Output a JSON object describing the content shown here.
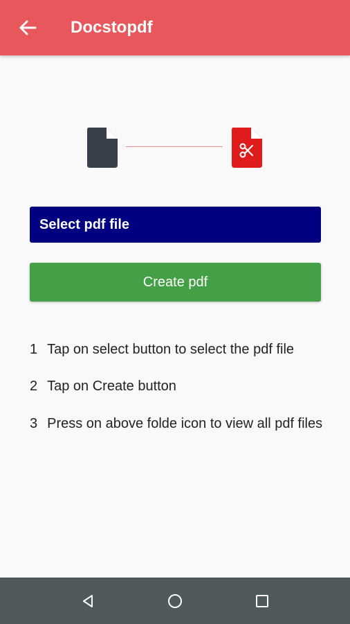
{
  "appbar": {
    "title": "Docstopdf",
    "back_icon": "arrow-left-icon",
    "color": "#e8575b"
  },
  "illustration": {
    "source_icon": "document-icon",
    "target_icon": "pdf-scissors-icon",
    "source_color": "#37404a",
    "target_color": "#e01b1b"
  },
  "buttons": {
    "select_label": "Select pdf file",
    "create_label": "Create pdf",
    "select_color": "#000080",
    "create_color": "#43a047"
  },
  "instructions": [
    {
      "num": "1",
      "text": "Tap on select button to select the pdf file"
    },
    {
      "num": "2",
      "text": "Tap on Create button"
    },
    {
      "num": "3",
      "text": "Press on above folde icon to view all pdf files"
    }
  ],
  "navbar": {
    "icons": [
      "nav-back-icon",
      "nav-home-icon",
      "nav-recents-icon"
    ]
  }
}
